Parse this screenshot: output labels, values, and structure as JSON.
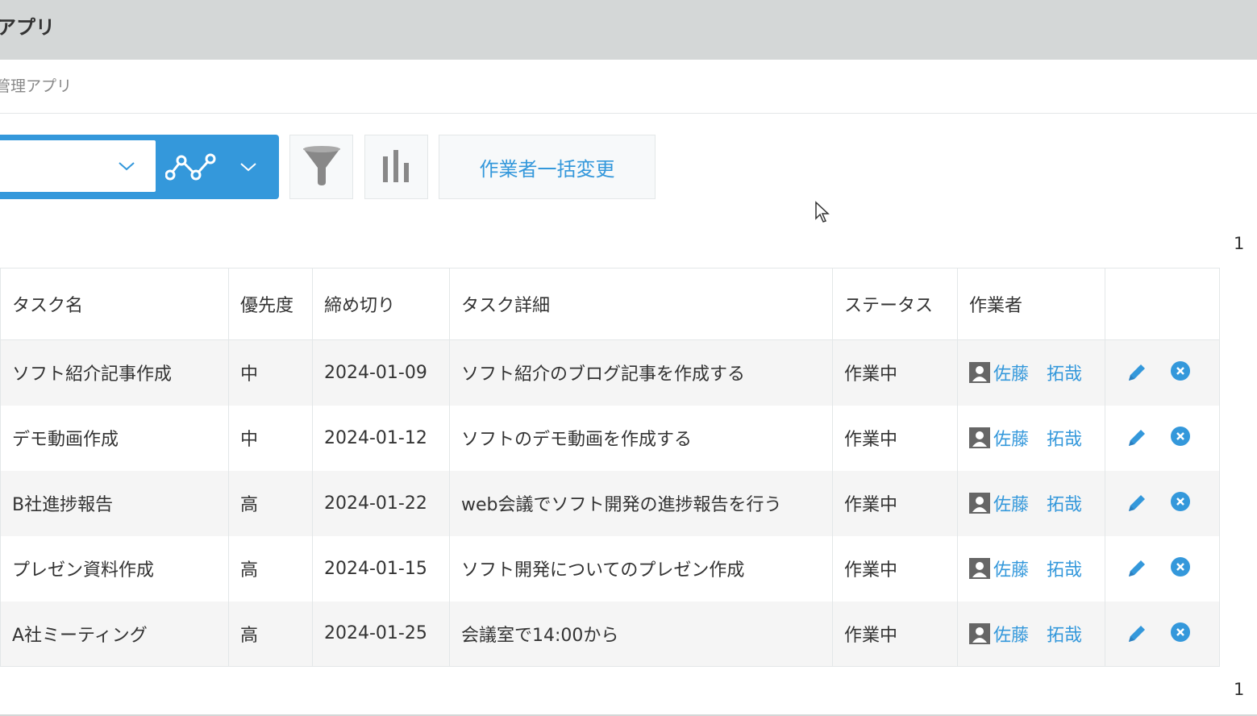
{
  "header": {
    "title": "アプリ"
  },
  "breadcrumb": {
    "text": "管理アプリ"
  },
  "toolbar": {
    "view_select_value": "",
    "bulk_change_label": "作業者一括変更"
  },
  "pagination": {
    "top": "1",
    "bottom": "1"
  },
  "table": {
    "columns": [
      "タスク名",
      "優先度",
      "締め切り",
      "タスク詳細",
      "ステータス",
      "作業者",
      ""
    ],
    "rows": [
      {
        "task": "ソフト紹介記事作成",
        "priority": "中",
        "deadline": "2024-01-09",
        "detail": "ソフト紹介のブログ記事を作成する",
        "status": "作業中",
        "assignee": "佐藤　拓哉"
      },
      {
        "task": "デモ動画作成",
        "priority": "中",
        "deadline": "2024-01-12",
        "detail": "ソフトのデモ動画を作成する",
        "status": "作業中",
        "assignee": "佐藤　拓哉"
      },
      {
        "task": "B社進捗報告",
        "priority": "高",
        "deadline": "2024-01-22",
        "detail": "web会議でソフト開発の進捗報告を行う",
        "status": "作業中",
        "assignee": "佐藤　拓哉"
      },
      {
        "task": "プレゼン資料作成",
        "priority": "高",
        "deadline": "2024-01-15",
        "detail": "ソフト開発についてのプレゼン作成",
        "status": "作業中",
        "assignee": "佐藤　拓哉"
      },
      {
        "task": "A社ミーティング",
        "priority": "高",
        "deadline": "2024-01-25",
        "detail": "会議室で14:00から",
        "status": "作業中",
        "assignee": "佐藤　拓哉"
      }
    ]
  },
  "icons": {
    "view_chevron": "chevron-down-icon",
    "graph": "line-graph-icon",
    "filter": "filter-icon",
    "bar_graph": "bar-chart-icon",
    "edit": "pencil-icon",
    "delete": "close-circle-icon",
    "user": "user-icon",
    "cursor": "cursor-icon"
  },
  "colors": {
    "accent": "#3498db",
    "header_bg": "#d4d7d7",
    "row_alt": "#f5f5f5",
    "icon_gray": "#666666"
  }
}
